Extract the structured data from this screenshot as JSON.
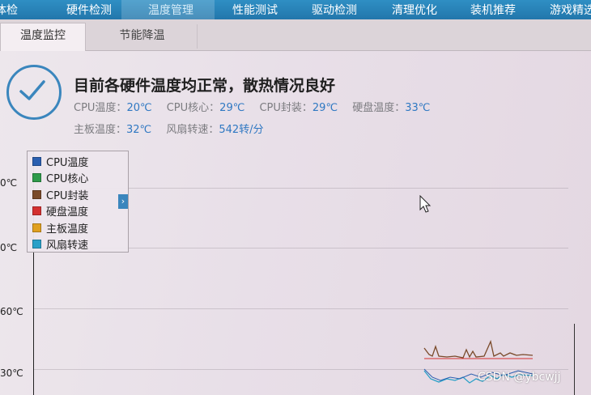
{
  "nav": {
    "items": [
      "体检",
      "硬件检测",
      "温度管理",
      "性能测试",
      "驱动检测",
      "清理优化",
      "装机推荐",
      "游戏精选"
    ]
  },
  "tabs": [
    "温度监控",
    "节能降温"
  ],
  "status": {
    "headline": "目前各硬件温度均正常，散热情况良好",
    "readings": [
      {
        "label": "CPU温度：",
        "value": "20℃"
      },
      {
        "label": "CPU核心：",
        "value": "29℃"
      },
      {
        "label": "CPU封装：",
        "value": "29℃"
      },
      {
        "label": "硬盘温度：",
        "value": "33℃"
      },
      {
        "label": "主板温度：",
        "value": "32℃"
      },
      {
        "label": "风扇转速：",
        "value": "542转/分"
      }
    ]
  },
  "chart": {
    "y_ticks": [
      "0℃",
      "0℃",
      "60℃",
      "30℃"
    ],
    "legend": [
      {
        "label": "CPU温度",
        "color": "#2a5fb0"
      },
      {
        "label": "CPU核心",
        "color": "#2e9a4a"
      },
      {
        "label": "CPU封装",
        "color": "#7a4a2a"
      },
      {
        "label": "硬盘温度",
        "color": "#d43030"
      },
      {
        "label": "主板温度",
        "color": "#e0a020"
      },
      {
        "label": "风扇转速",
        "color": "#2aa0c8"
      }
    ],
    "legend_toggle": "›"
  },
  "watermark": "CSDN @ybcwjj"
}
